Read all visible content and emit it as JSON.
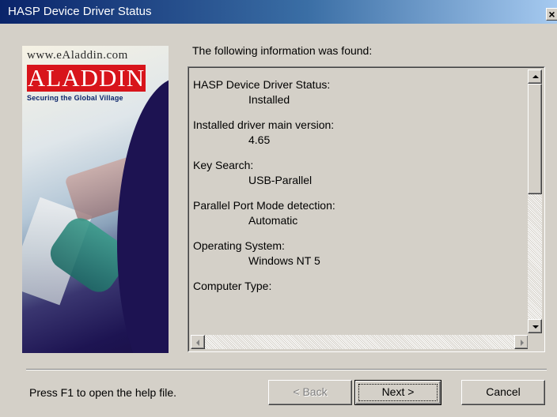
{
  "window": {
    "title": "HASP Device Driver Status",
    "close_label": "×"
  },
  "banner": {
    "url": "www.eAladdin.com",
    "logo": "ALADDIN",
    "tagline": "Securing the Global Village"
  },
  "heading": "The following information was found:",
  "entries": [
    {
      "label": "HASP Device Driver Status:",
      "value": "Installed"
    },
    {
      "label": "Installed driver main version:",
      "value": "4.65"
    },
    {
      "label": "Key Search:",
      "value": "USB-Parallel"
    },
    {
      "label": "Parallel Port Mode detection:",
      "value": "Automatic"
    },
    {
      "label": "Operating System:",
      "value": "Windows NT 5"
    },
    {
      "label": "Computer Type:",
      "value": ""
    }
  ],
  "footer": {
    "help_text": "Press F1 to open the help file.",
    "back_label": "< Back",
    "next_label": "Next >",
    "cancel_label": "Cancel"
  }
}
